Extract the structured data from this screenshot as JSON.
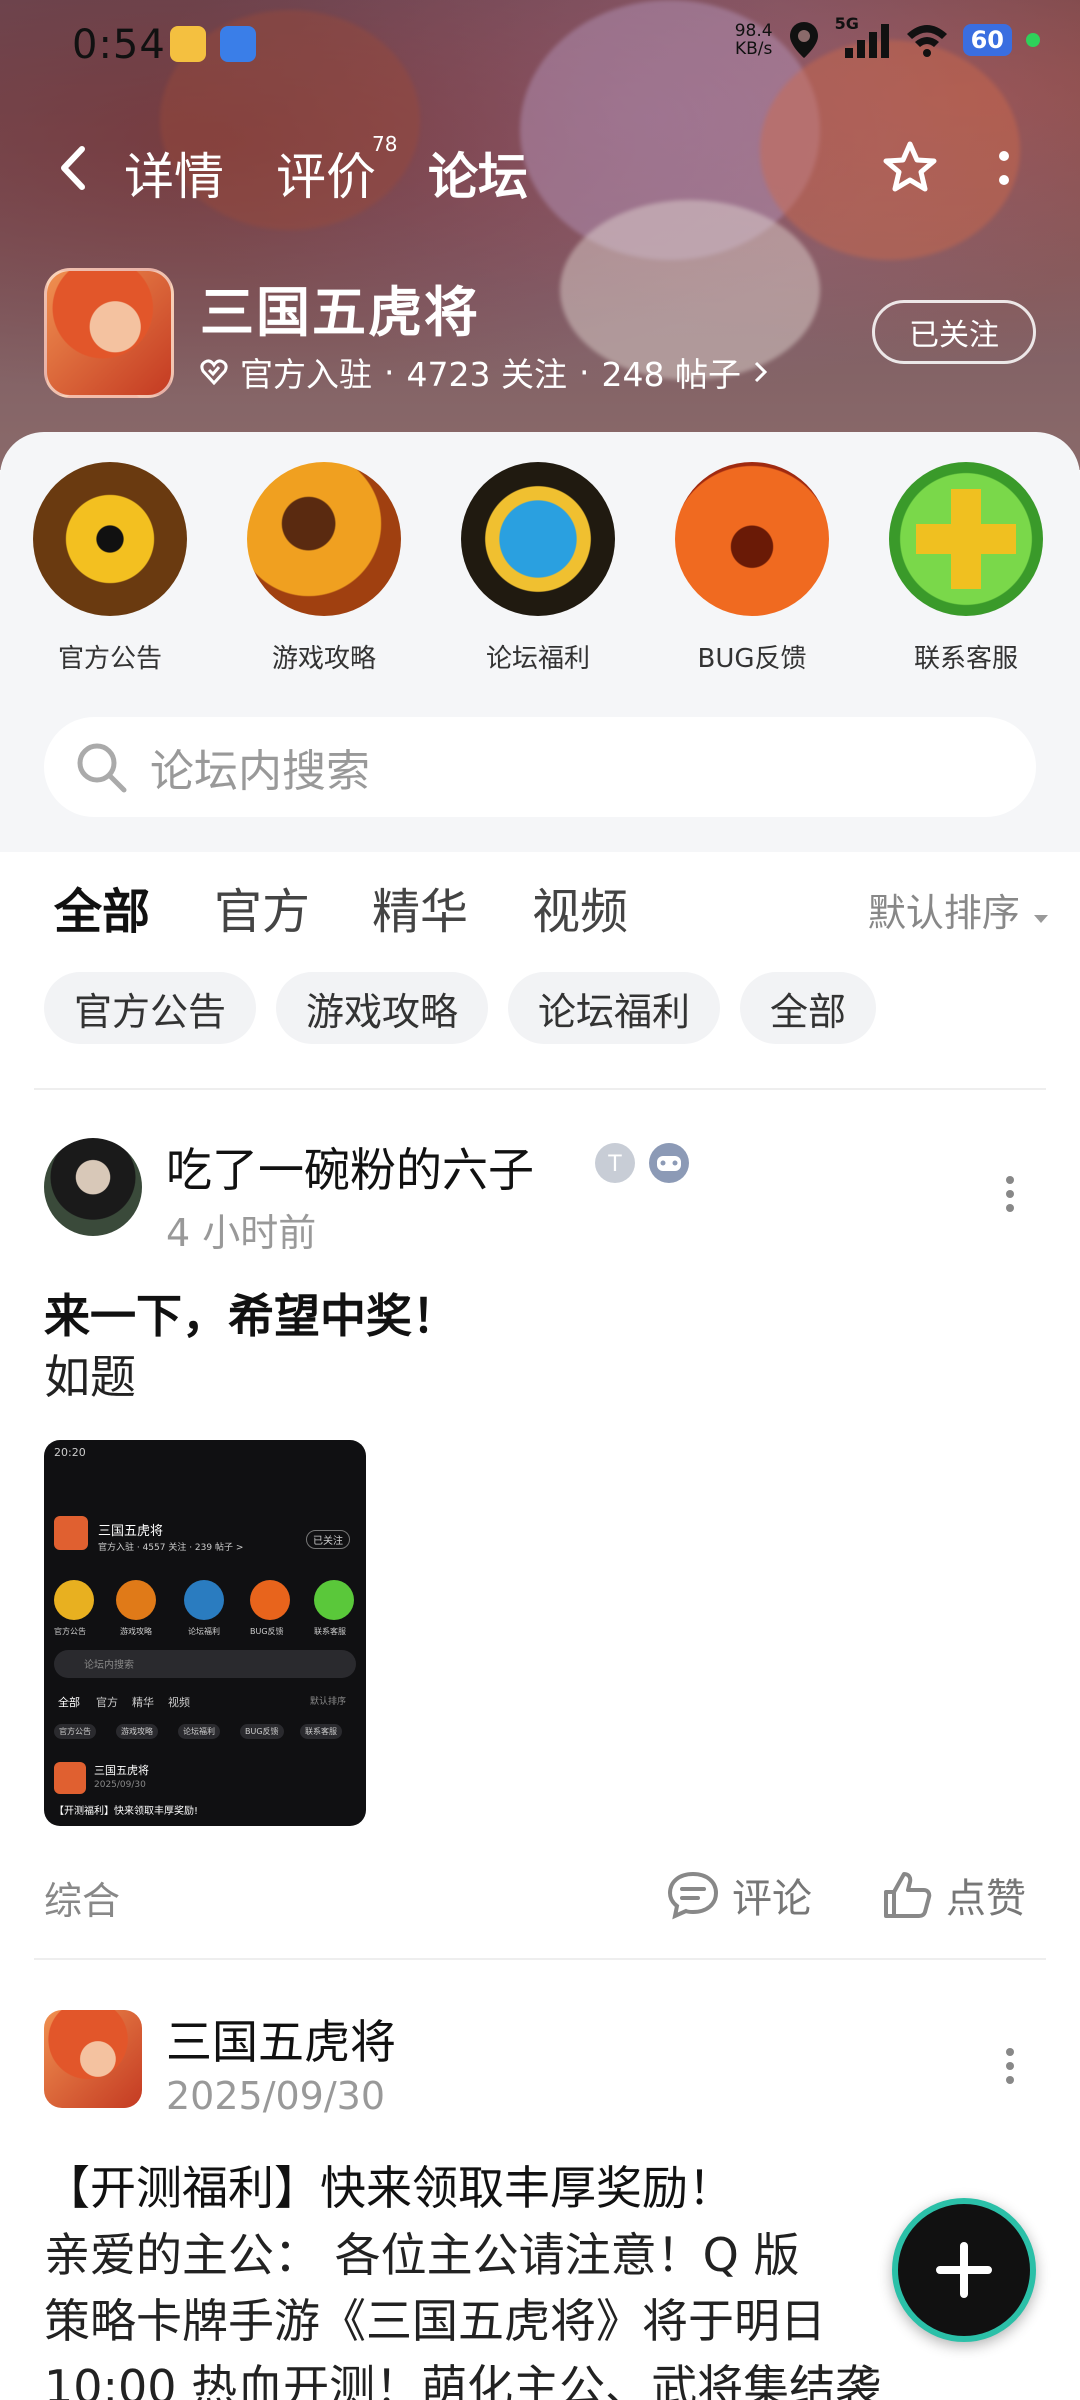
{
  "status_bar": {
    "time": "0:54",
    "net_speed_value": "98.4",
    "net_speed_unit": "KB/s",
    "network": "5G",
    "battery": "60"
  },
  "nav": {
    "tabs": [
      "详情",
      "评价",
      "论坛"
    ],
    "review_count": "78",
    "active_tab": "论坛"
  },
  "game": {
    "name": "三国五虎将",
    "verified": "官方入驻",
    "followers": "4723 关注",
    "posts": "248 帖子",
    "separator": "·",
    "follow_state": "已关注"
  },
  "categories": [
    {
      "label": "官方公告",
      "icon": "eye-icon",
      "color": "#e8b020"
    },
    {
      "label": "游戏攻略",
      "icon": "strategy-icon",
      "color": "#e07a18"
    },
    {
      "label": "论坛福利",
      "icon": "gift-icon",
      "color": "#2a7cc0"
    },
    {
      "label": "BUG反馈",
      "icon": "pumpkin-icon",
      "color": "#e8641c"
    },
    {
      "label": "联系客服",
      "icon": "plus-cross-icon",
      "color": "#5ac83a"
    }
  ],
  "search": {
    "placeholder": "论坛内搜索"
  },
  "filter_tabs": [
    "全部",
    "官方",
    "精华",
    "视频"
  ],
  "sort_label": "默认排序",
  "chips": [
    "官方公告",
    "游戏攻略",
    "论坛福利",
    "全部"
  ],
  "posts": [
    {
      "author": "吃了一碗粉的六子",
      "time": "4 小时前",
      "title": "来一下，希望中奖！",
      "body": "如题",
      "tag": "综合",
      "comment_label": "评论",
      "like_label": "点赞",
      "thumbnail": {
        "time": "20:20",
        "game_name": "三国五虎将",
        "meta": "官方入驻 · 4557 关注 · 239 帖子 >",
        "follow": "已关注",
        "categories": [
          "官方公告",
          "游戏攻略",
          "论坛福利",
          "BUG反馈",
          "联系客服"
        ],
        "search": "论坛内搜索",
        "tabs": [
          "全部",
          "官方",
          "精华",
          "视频"
        ],
        "sort": "默认排序",
        "chips": [
          "官方公告",
          "游戏攻略",
          "论坛福利",
          "BUG反馈",
          "联系客服"
        ],
        "post_author": "三国五虎将",
        "post_date": "2025/09/30",
        "post_title": "【开测福利】快来领取丰厚奖励!"
      }
    },
    {
      "author": "三国五虎将",
      "time": "2025/09/30",
      "title": "【开测福利】快来领取丰厚奖励！",
      "body_lines": [
        "亲爱的主公：  各位主公请注意！Q 版",
        "策略卡牌手游《三国五虎将》将于明日",
        "10:00 热血开测！萌化主公、武将集结袭"
      ]
    }
  ]
}
